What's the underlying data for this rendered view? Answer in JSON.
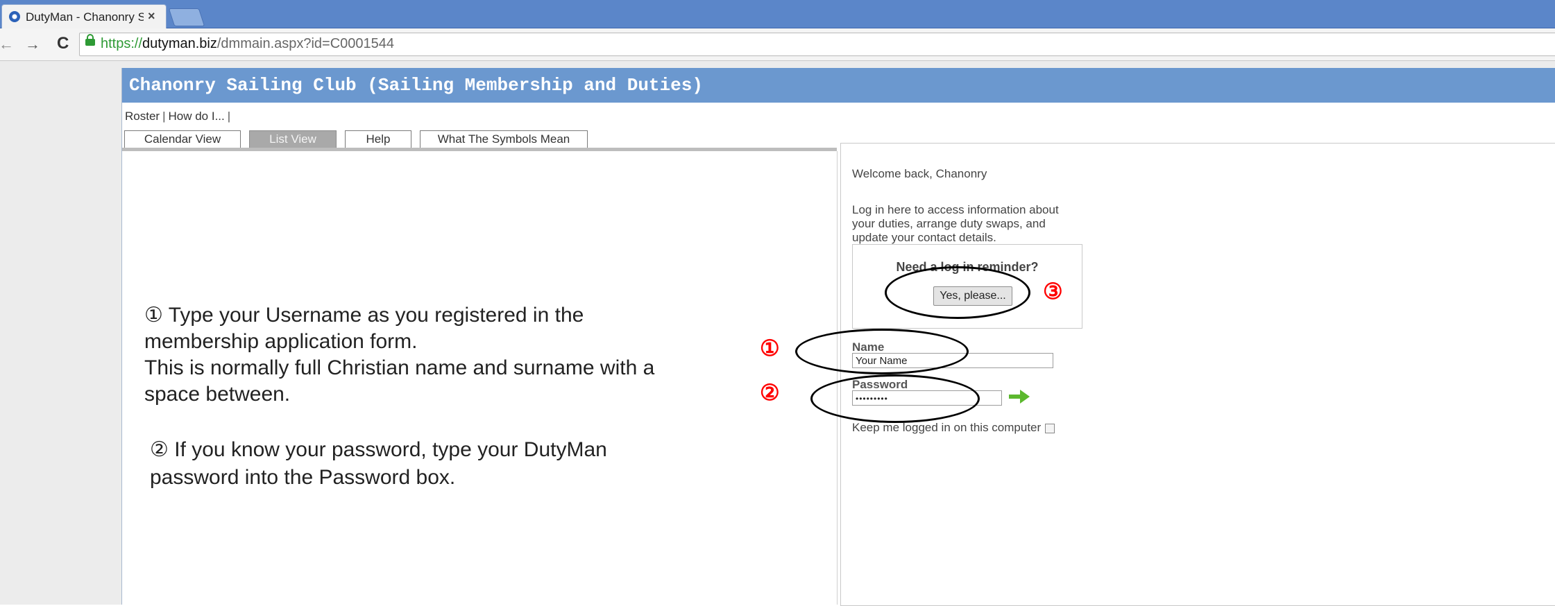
{
  "browser": {
    "tab_title": "DutyMan - Chanonry Sailing Club",
    "close_glyph": "×",
    "url_scheme": "https://",
    "url_host": "dutyman.biz",
    "url_path": "/dmmain.aspx?id=C0001544"
  },
  "site": {
    "title": "Chanonry Sailing Club (Sailing Membership and Duties)",
    "menu": [
      "Roster",
      "How do I..."
    ]
  },
  "view_tabs": [
    {
      "label": "Calendar View",
      "active": false
    },
    {
      "label": "List View",
      "active": true
    },
    {
      "label": "Help",
      "active": false
    },
    {
      "label": "What The Symbols Mean",
      "active": false
    }
  ],
  "instructions": {
    "step1_line1": "① Type your Username as you registered in the",
    "step1_line2": "membership application form.",
    "step1_line3": "This is normally full Christian name and surname with a",
    "step1_line4": "space between.",
    "step2_line1": "② If you know your password, type your DutyMan",
    "step2_line2": "password into the Password box."
  },
  "login": {
    "welcome": "Welcome back, Chanonry",
    "intro_line1": "Log in here to access information about",
    "intro_line2": "your duties, arrange duty swaps, and",
    "intro_line3": "update your contact details.",
    "reminder_title": "Need a log in reminder?",
    "reminder_button": "Yes, please...",
    "name_label": "Name",
    "name_value": "Your Name",
    "password_label": "Password",
    "password_value": "•••••••••",
    "keep_logged_in": "Keep me logged in on this computer"
  },
  "markers": {
    "one": "①",
    "two": "②",
    "three": "③"
  },
  "colors": {
    "header": "#6b98cf",
    "marker": "#ff0000",
    "go_arrow": "#5cb82e",
    "active_tab": "#a9a9a9"
  }
}
